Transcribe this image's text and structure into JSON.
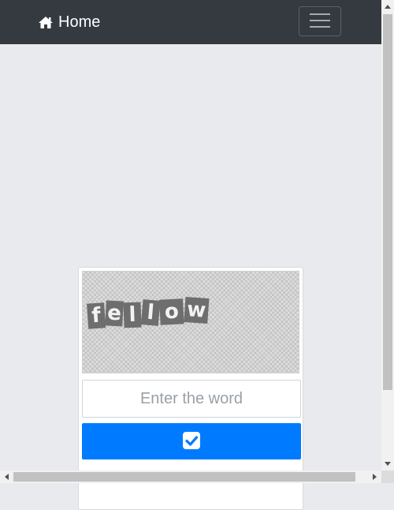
{
  "navbar": {
    "brand_icon": "home-icon",
    "brand_label": "Home",
    "toggler_icon": "hamburger-icon",
    "background": "#343a40"
  },
  "captcha": {
    "letters": [
      "f",
      "e",
      "l",
      "l",
      "o",
      "w"
    ],
    "input_placeholder": "Enter the word",
    "input_value": "",
    "submit_icon": "check-square-icon",
    "submit_color": "#007bff"
  },
  "scrollbars": {
    "vertical": true,
    "horizontal": true
  }
}
